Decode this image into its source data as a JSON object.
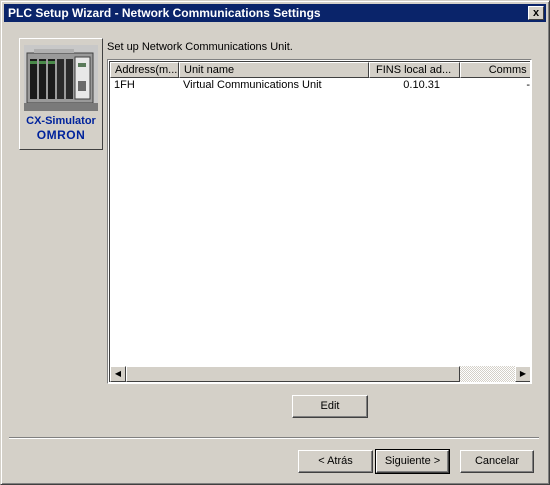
{
  "window": {
    "title": "PLC Setup Wizard - Network Communications Settings",
    "close_label": "x"
  },
  "logo": {
    "product": "CX-Simulator",
    "brand": "OMRON",
    "icon": "plc-hardware-image"
  },
  "instruction": "Set up Network Communications Unit.",
  "table": {
    "columns": [
      "Address(m...",
      "Unit name",
      "FINS local ad...",
      "Comms S"
    ],
    "rows": [
      [
        "1FH",
        "Virtual Communications Unit",
        "0.10.31",
        "-"
      ]
    ]
  },
  "buttons": {
    "edit": "Edit",
    "back": "< Atrás",
    "next": "Siguiente >",
    "cancel": "Cancelar"
  },
  "colors": {
    "title_bar": "#0a246a",
    "dialog_bg": "#d4d0c8",
    "logo_text": "#00239c"
  }
}
